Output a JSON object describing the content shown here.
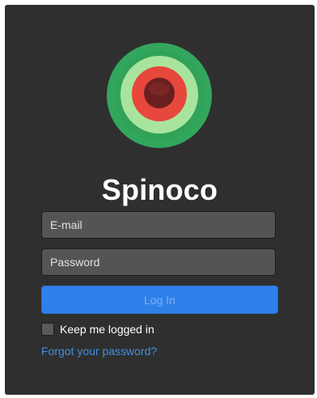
{
  "app": {
    "name": "Spinoco",
    "logo": "spinoco-logo-icon",
    "colors": {
      "background": "#2f2f2f",
      "accent": "#2f80ea",
      "link": "#3d8fe8",
      "logo_outer": "#33a65d",
      "logo_middle": "#a9e49e",
      "logo_inner": "#e8473b",
      "logo_center": "#6a1f1f"
    }
  },
  "login": {
    "email_placeholder": "E-mail",
    "password_placeholder": "Password",
    "submit_label": "Log In",
    "remember_label": "Keep me logged in",
    "remember_checked": false,
    "forgot_link": "Forgot your password?"
  }
}
